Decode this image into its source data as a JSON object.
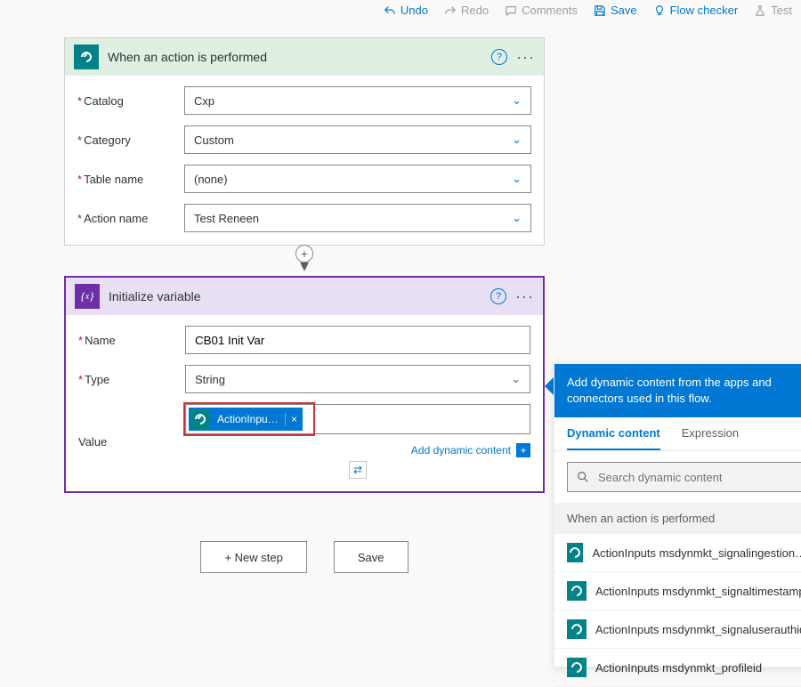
{
  "commands": {
    "undo": "Undo",
    "redo": "Redo",
    "comments": "Comments",
    "save": "Save",
    "flow_checker": "Flow checker",
    "test": "Test"
  },
  "trigger": {
    "title": "When an action is performed",
    "fields": {
      "catalog": {
        "label": "Catalog",
        "value": "Cxp"
      },
      "category": {
        "label": "Category",
        "value": "Custom"
      },
      "table": {
        "label": "Table name",
        "value": "(none)"
      },
      "action": {
        "label": "Action name",
        "value": "Test Reneen"
      }
    }
  },
  "action": {
    "title": "Initialize variable",
    "name_label": "Name",
    "name_value": "CB01 Init Var",
    "type_label": "Type",
    "type_value": "String",
    "value_label": "Value",
    "token_label": "ActionInputs m...",
    "add_dynamic": "Add dynamic content"
  },
  "footer": {
    "new_step": "+ New step",
    "save": "Save"
  },
  "dc_panel": {
    "banner": "Add dynamic content from the apps and connectors used in this flow.",
    "tab_dynamic": "Dynamic content",
    "tab_expression": "Expression",
    "search_placeholder": "Search dynamic content",
    "section": "When an action is performed",
    "items": [
      "ActionInputs msdynmkt_signalingestiontimestamp",
      "ActionInputs msdynmkt_signaltimestamp",
      "ActionInputs msdynmkt_signaluserauthid",
      "ActionInputs msdynmkt_profileid"
    ]
  }
}
